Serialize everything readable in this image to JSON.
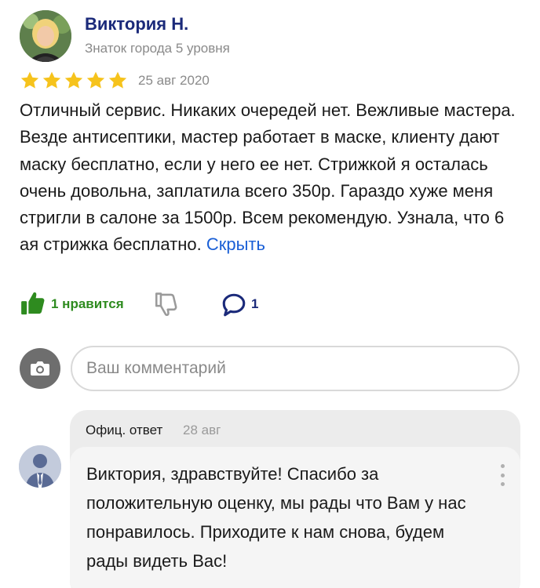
{
  "review": {
    "author_name": "Виктория Н.",
    "author_level": "Знаток города 5 уровня",
    "rating": 5,
    "date": "25 авг 2020",
    "text": "Отличный сервис. Никаких очередей нет. Вежливые мастера. Везде антисептики, мастер работает в маске, клиенту дают маску бесплатно, если у него ее нет. Стрижкой я осталась очень довольна, заплатила всего 350р. Гараздо хуже меня стригли в салоне за 1500р. Всем рекомендую. Узнала, что 6 ая стрижка бесплатно.",
    "hide_label": "Скрыть"
  },
  "actions": {
    "like_count": "1 нравится",
    "comment_count": "1"
  },
  "comment_box": {
    "placeholder": "Ваш комментарий"
  },
  "official_reply": {
    "label": "Офиц. ответ",
    "date": "28 авг",
    "text": "Виктория, здравствуйте! Спасибо за положительную оценку, мы рады что Вам у нас понравилось. Приходите к нам снова, будем рады видеть Вас!"
  },
  "colors": {
    "star": "#f6c31c",
    "like_green": "#2e8b1f",
    "link_blue": "#1a5fd6",
    "name_navy": "#1b2a7a"
  },
  "icons": {
    "like": "thumbs-up-icon",
    "dislike": "thumbs-down-icon",
    "comment": "speech-bubble-icon",
    "camera": "camera-icon",
    "more": "more-vertical-icon"
  }
}
